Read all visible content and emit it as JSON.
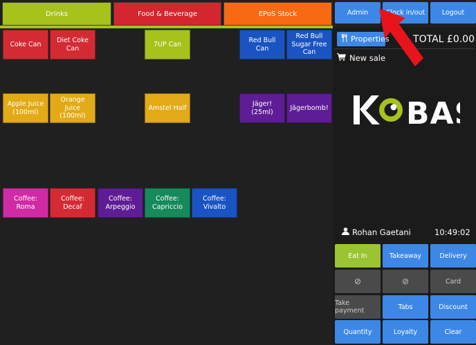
{
  "tabs": [
    {
      "label": "Drinks",
      "color": "#a7c21a"
    },
    {
      "label": "Food & Beverage",
      "color": "#d4262e"
    },
    {
      "label": "EPoS Stock",
      "color": "#f86a12"
    }
  ],
  "top_buttons": {
    "admin": "Admin",
    "clock": "Clock in/out",
    "logout": "Logout",
    "color": "#3d88e6"
  },
  "products": [
    {
      "label": "Coke Can",
      "color": "#d42a34"
    },
    {
      "label": "Diet Coke Can",
      "color": "#d42a34"
    },
    {
      "label": "7UP Can",
      "color": "#a7c21a"
    },
    {
      "label": "Red Bull Can",
      "color": "#1a54c2"
    },
    {
      "label": "Red Bull Sugar Free Can",
      "color": "#1a54c2"
    },
    {
      "label": "Apple Juice (100ml)",
      "color": "#e2aa16"
    },
    {
      "label": "Orange Juice (100ml)",
      "color": "#e2aa16"
    },
    {
      "label": "Amstel Half",
      "color": "#e2aa16"
    },
    {
      "label": "Jäger! (25ml)",
      "color": "#5e1d94"
    },
    {
      "label": "Jägerbomb!",
      "color": "#5e1d94"
    },
    {
      "label": "Coffee: Roma",
      "color": "#d02aa4"
    },
    {
      "label": "Coffee: Decaf",
      "color": "#d42a34"
    },
    {
      "label": "Coffee: Arpeggio",
      "color": "#5e1d94"
    },
    {
      "label": "Coffee: Capriccio",
      "color": "#168a5a"
    },
    {
      "label": "Coffee: Vivalto",
      "color": "#1a54c2"
    }
  ],
  "sale": {
    "properties_label": "Properties",
    "total": "TOTAL £0.00",
    "new_sale": "New sale",
    "logo_text": "KOBAS",
    "staff": "Rohan Gaetani",
    "time": "10:49:02"
  },
  "pos_buttons": [
    {
      "label": "Eat In",
      "color": "#9ac431"
    },
    {
      "label": "Takeaway",
      "color": "#3d88e6"
    },
    {
      "label": "Delivery",
      "color": "#3d88e6"
    },
    {
      "label": "⊘",
      "color": "#4a4a4a"
    },
    {
      "label": "⊘",
      "color": "#4a4a4a"
    },
    {
      "label": "Card",
      "color": "#4a4a4a"
    },
    {
      "label": "Take payment",
      "color": "#4a4a4a"
    },
    {
      "label": "Tabs",
      "color": "#3d88e6"
    },
    {
      "label": "Discount",
      "color": "#3d88e6"
    },
    {
      "label": "Quantity",
      "color": "#3d88e6"
    },
    {
      "label": "Loyalty",
      "color": "#3d88e6"
    },
    {
      "label": "Clear",
      "color": "#3d88e6"
    }
  ],
  "annotation": {
    "arrow_color": "#e8141c"
  }
}
